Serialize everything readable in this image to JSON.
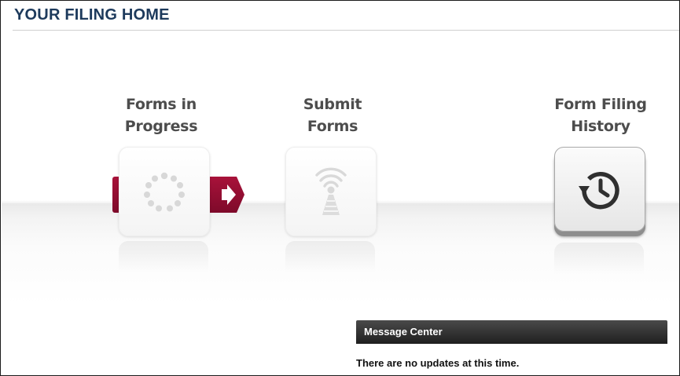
{
  "page": {
    "title": "YOUR FILING HOME"
  },
  "steps": [
    {
      "label_line1": "Forms in",
      "label_line2": "Progress",
      "icon": "spinner-icon",
      "state": "faded"
    },
    {
      "label_line1": "Submit",
      "label_line2": "Forms",
      "icon": "broadcast-tower-icon",
      "state": "faded"
    },
    {
      "label_line1": "Form Filing",
      "label_line2": "History",
      "icon": "history-clock-icon",
      "state": "active"
    }
  ],
  "message_center": {
    "title": "Message Center",
    "message": "There are no updates at this time."
  },
  "colors": {
    "title_text": "#1d3a5c",
    "ribbon": "#9a1036",
    "step_label": "#4d4d4d",
    "message_header": "#2b2b2b"
  }
}
